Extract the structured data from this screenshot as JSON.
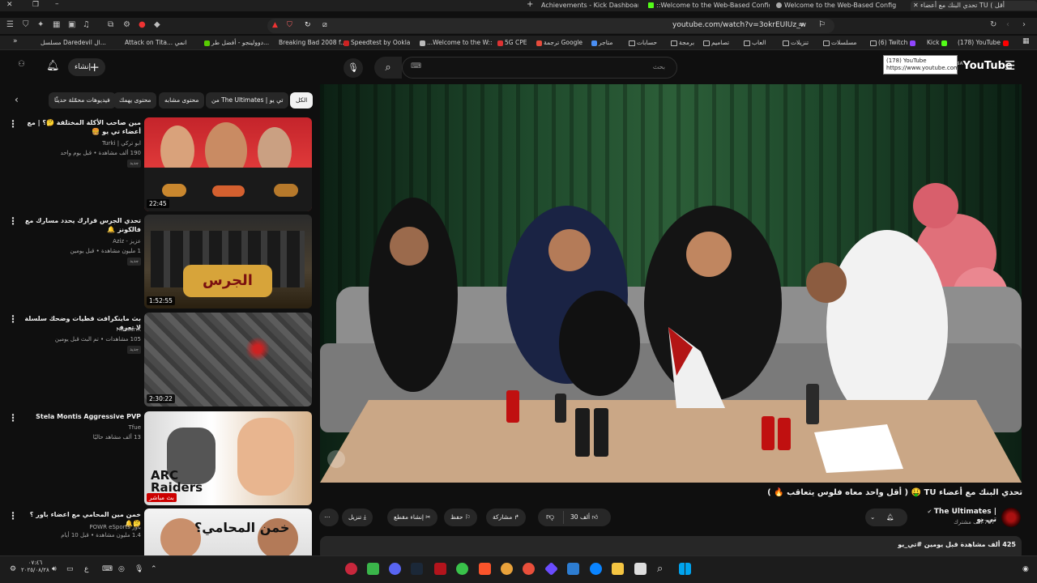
{
  "browser": {
    "tabs": [
      {
        "label": "تحدي البنك مع أعضاء TU ( أقل",
        "active": true
      },
      {
        "label": "Welcome to the Web-Based Config"
      },
      {
        "label": "::Welcome to the Web-Based Config"
      },
      {
        "label": "Achievements - Kick Dashboard"
      }
    ],
    "url": "youtube.com/watch?v=3okrEUlUz_w",
    "bookmarks": [
      "(178) YouTube",
      "Kick",
      "(6) Twitch",
      "مسلسلات",
      "تنزيلات",
      "العاب",
      "تصاميم",
      "برمجة",
      "حسابات",
      "متاجر",
      "ترجمة Google",
      "5G CPE",
      "...Welcome to the W::",
      "Speedtest by Ookla",
      "Breaking Bad 2008 f...",
      "دوولينجو - أفضل طر...",
      "Attack on Tita... انمي",
      "مسلسل Daredevil ال..."
    ],
    "tooltip": {
      "title": "(178) YouTube",
      "url": "https://www.youtube.com"
    }
  },
  "youtube": {
    "logo": "YouTube",
    "region": "SA",
    "search_placeholder": "بحث",
    "create_label": "إنشاء",
    "chips": [
      "الكل",
      "من The Ultimates | تي يو",
      "محتوى مشابه",
      "محتوى يهمك",
      "فيديوهات محمّلة حديثًا"
    ],
    "sidebar_videos": [
      {
        "title": "مين صاحب الأكلة المختلفة 🤔؟ | مع أعضاء تي يو 🍔",
        "channel": "ابو تركي | Turki",
        "meta": "190 ألف مشاهدة • قبل يوم واحد",
        "badge": "جديد",
        "duration": "22:45"
      },
      {
        "title": "تحدي الجرس قرارك يحدد مسارك مع فالكونز 🔔",
        "channel": "عزيز - Aziz",
        "meta": "1 مليون مشاهدة • قبل يومين",
        "badge": "جديد",
        "duration": "1:52:55"
      },
      {
        "title": "بث ماينكرافت قطيات وضحك سلسلة لا تعرف",
        "channel": "HassanX",
        "meta": "105 مشاهدات • تم البث قبل يومين",
        "badge": "جديد",
        "duration": "2:30:22"
      },
      {
        "title": "Stela Montis Aggressive PVP",
        "channel": "Tfue",
        "meta": "13 ألف مشاهد حاليًا",
        "badge": "",
        "duration": "بث مباشر"
      },
      {
        "title": "خمن مين المحامي مع اعضاء باور ؟ 🤔🔔",
        "channel": "باور POWR eSports",
        "meta": "1.4 مليون مشاهدة • قبل 10 أيام",
        "badge": "",
        "duration": ""
      }
    ],
    "video": {
      "title": "تحدي البنك مع أعضاء TU 🤑 ( أقل واحد معاه فلوس يتعاقب 🔥 )",
      "channel": "The Ultimates | تي يو",
      "subscribers": "707 ألف مشترك",
      "likes": "30 ألف",
      "actions": {
        "share": "مشاركة",
        "save": "حفظ",
        "clip": "إنشاء مقطع",
        "download": "تنزيل"
      },
      "views_line": "425 ألف مشاهدة قبل يومين #تي_يو"
    }
  },
  "taskbar": {
    "time": "٠٧:٤٦",
    "date": "٢٠٢٥/٠٨/٢٨",
    "lang": "ع"
  },
  "colors": {
    "background": "#0f0f0f",
    "chip": "#272727",
    "accent_red": "#ff0000"
  }
}
